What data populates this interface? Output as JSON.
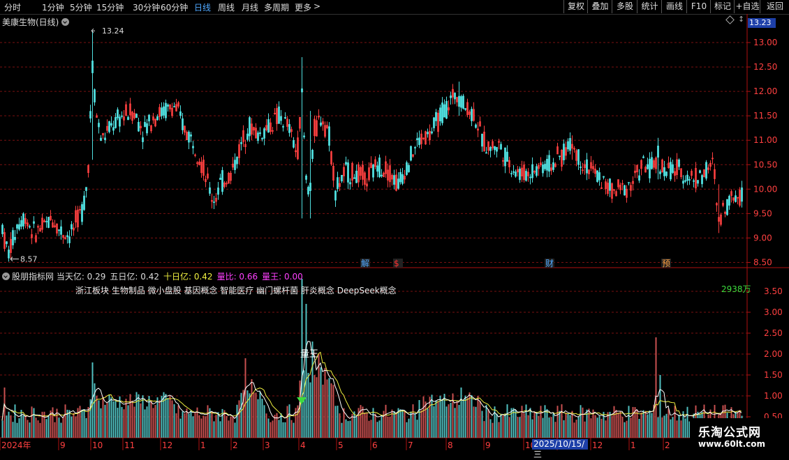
{
  "toolbar": {
    "periods": [
      "分时",
      "1分钟",
      "5分钟",
      "15分钟",
      "30分钟",
      "60分钟",
      "日线",
      "周线",
      "月线",
      "多周期",
      "更多"
    ],
    "active_period": "日线",
    "more_arrow": ">",
    "buttons": [
      "复权",
      "叠加",
      "多股",
      "统计",
      "画线",
      "F10",
      "标记",
      "+自选",
      "返回"
    ]
  },
  "main": {
    "title": "美康生物(日线)",
    "current_price": "13.23",
    "high_label": "13.24",
    "low_label": "8.57",
    "y_ticks": [
      "13.00",
      "12.50",
      "12.00",
      "11.50",
      "11.00",
      "10.50",
      "10.00",
      "9.50",
      "9.00",
      "8.50"
    ],
    "event_markers": [
      {
        "label": "解",
        "color": "#4fa8ff"
      },
      {
        "label": "$",
        "color": "#ff3030"
      },
      {
        "label": "财",
        "color": "#4fa8ff"
      },
      {
        "label": "预",
        "color": "#ff9f40"
      }
    ]
  },
  "sub": {
    "title": "股朋指标网",
    "fields": [
      {
        "label": "当天亿:",
        "value": "0.29",
        "color": "#dddddd"
      },
      {
        "label": "五日亿:",
        "value": "0.42",
        "color": "#dddddd"
      },
      {
        "label": "十日亿:",
        "value": "0.42",
        "color": "#f0f040"
      },
      {
        "label": "量比:",
        "value": "0.66",
        "color": "#ff40ff"
      },
      {
        "label": "量王:",
        "value": "0.00",
        "color": "#ff40ff"
      }
    ],
    "concepts": "浙江板块 生物制品 微小盘股 基因概念 智能医疗 幽门螺杆菌 肝炎概念 DeepSeek概念",
    "volume_label": "2938万",
    "king_label": "量王",
    "y_ticks": [
      "3.50",
      "3.00",
      "2.50",
      "2.00",
      "1.50",
      "1.00",
      "0.50"
    ]
  },
  "x_axis": {
    "labels": [
      "2024年",
      "9",
      "10",
      "11",
      "12",
      "1",
      "2",
      "3",
      "4",
      "5",
      "6",
      "7",
      "8",
      "9",
      "10",
      "11",
      "12",
      "1",
      "2"
    ],
    "date_box": "2025/10/15/三"
  },
  "watermark": {
    "line1": "乐淘公式网",
    "line2": "www.60lt.com"
  },
  "colors": {
    "up": "#ff4040",
    "down": "#50e0e0",
    "badge": "#1d3fa8",
    "grid": "#7a1010"
  },
  "chart_data": {
    "type": "candlestick",
    "title": "美康生物(日线)",
    "price_high": 13.24,
    "price_low": 8.57,
    "last_price": 13.23,
    "ylim": [
      8.45,
      13.3
    ],
    "volume_ylim": [
      0,
      3.8
    ],
    "ma_series": [
      "五日亿",
      "十日亿"
    ]
  }
}
